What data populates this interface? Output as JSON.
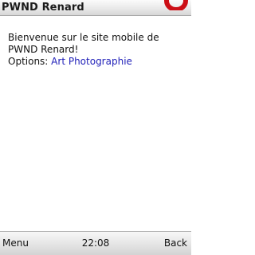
{
  "window": {
    "title": "PWND Renard"
  },
  "main": {
    "welcome_text": "Bienvenue sur le site mobile de PWND Renard!",
    "options_label": "Options:",
    "options_link": "Art Photographie"
  },
  "softkeys": {
    "left": "Menu",
    "clock": "22:08",
    "right": "Back"
  },
  "colors": {
    "link": "#1f1fb8",
    "opera_red": "#cc0f16"
  },
  "icons": {
    "browser_logo": "opera-logo-icon"
  }
}
